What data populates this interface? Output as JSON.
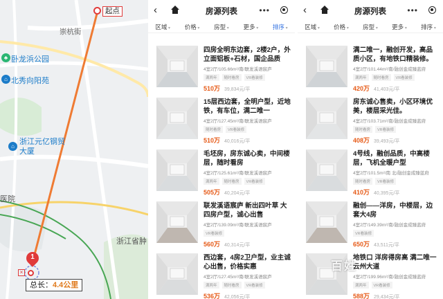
{
  "map": {
    "start_label": "起点",
    "road_label": "崇杭街",
    "pois": [
      "卧龙浜公园",
      "北秀向阳苑",
      "浙江元亿钢贸\n大厦"
    ],
    "poi_icons": [
      "tree-icon",
      "building-icon",
      "building-icon"
    ],
    "area_label_1": "浙江省肿",
    "area_label_2": "医院",
    "marker_number": "1",
    "distance_label": "总长：",
    "distance_value": "4.4公里"
  },
  "panels": [
    {
      "title": "房源列表",
      "filters": [
        "区域",
        "价格",
        "房型",
        "更多",
        "排序"
      ],
      "active_filter": 4,
      "listings": [
        {
          "title": "四房全明东边套，2楼2户，外立面铝板+石材，国企品质",
          "sub": "4室2厅/105.66m²/南/联发溪语宸庐",
          "tags": [
            "满两年",
            "随时看房",
            "VR看装修"
          ],
          "price": "510万",
          "unit_price": "39,834元/平"
        },
        {
          "title": "15层西边套，全明户型，近地铁，有车位，满二唯一",
          "sub": "4室2厅/127.45m²/南/联发溪语宸庐",
          "tags": [
            "随时看房",
            "VR看装修"
          ],
          "price": "510万",
          "unit_price": "40,016元/平"
        },
        {
          "title": "毛坯房，房东诚心卖，中间楼层，随时看房",
          "sub": "4室2厅/125.61m²/南/联发溪语宸庐",
          "tags": [
            "满两年",
            "随时看房",
            "VR看装修"
          ],
          "price": "505万",
          "unit_price": "40,204元/平"
        },
        {
          "title": "联发溪语宸庐 新出四叶草 大四房户型，诚心出售",
          "sub": "4室2厅/139.09m²/南/联发溪语宸庐",
          "tags": [
            "VR看装修"
          ],
          "price": "560万",
          "unit_price": "40,314元/平"
        },
        {
          "title": "西边套，4房2卫户型，业主诚心出售，价格实惠",
          "sub": "4室2厅/127.45m²/南/联发溪语宸庐",
          "tags": [
            "满两年",
            "随时看房",
            "VR看装修"
          ],
          "price": "536万",
          "unit_price": "42,056元/平"
        }
      ]
    },
    {
      "title": "房源列表",
      "filters": [
        "区域",
        "价格",
        "房型",
        "更多",
        "排序"
      ],
      "active_filter": -1,
      "listings": [
        {
          "title": "满二唯一，融创开发，高品质小区，有地铁口精装修。",
          "sub": "4室2厅/101.44m²/南/融创金成臻蓝府",
          "tags": [
            "满两年",
            "随时看房",
            "VR看装修"
          ],
          "price": "420万",
          "unit_price": "41,403元/平"
        },
        {
          "title": "房东诚心售卖，小区环境优美，楼层采光佳。",
          "sub": "4室2厅/103.71m²/南/融创金成臻蓝府",
          "tags": [
            "随时看房",
            "VR看装修"
          ],
          "price": "408万",
          "unit_price": "39,493元/平"
        },
        {
          "title": "4号线，融创品质，中高楼层，飞机全暖户型",
          "sub": "4室2厅/101.5m²/南 北/融创金成臻蓝府",
          "tags": [
            "随时看房",
            "VR看装修"
          ],
          "price": "410万",
          "unit_price": "40,395元/平"
        },
        {
          "title": "融创——洋房，中楼层，边套大4房",
          "sub": "4室2厅/149.39m²/南/融创金成臻蓝府",
          "tags": [
            "VR看装修"
          ],
          "price": "650万",
          "unit_price": "43,511元/平"
        },
        {
          "title": "地铁口 洋房得房高 满二唯一 云州大道",
          "sub": "4室2厅/199.96m²/南/融创金成臻蓝府",
          "tags": [
            "满两年",
            "VR看装修"
          ],
          "price": "588万",
          "unit_price": "29,434元/平"
        }
      ]
    }
  ],
  "watermark": "百姓"
}
